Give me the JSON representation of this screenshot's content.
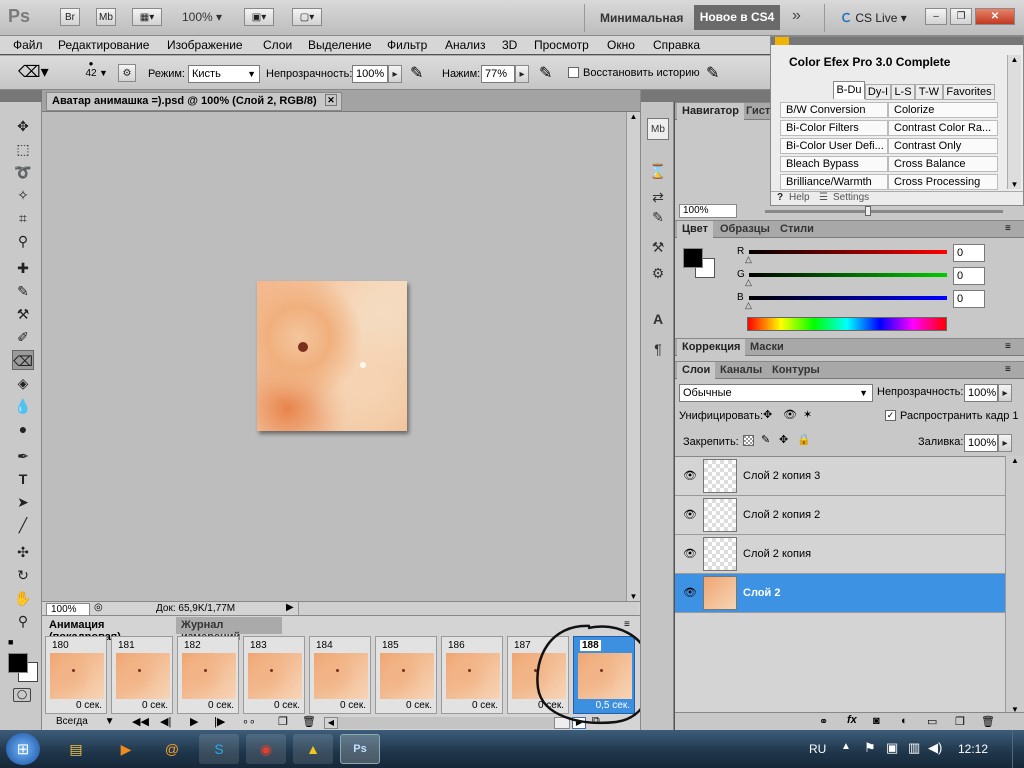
{
  "appbar": {
    "logo": "Ps",
    "bridge": "Br",
    "minibridge": "Mb",
    "zoom": "100%",
    "workspace": "Минимальная",
    "whats_new": "Новое в CS4",
    "cs_live": "CS Live"
  },
  "menu": [
    "Файл",
    "Редактирование",
    "Изображение",
    "Слои",
    "Выделение",
    "Фильтр",
    "Анализ",
    "3D",
    "Просмотр",
    "Окно",
    "Справка"
  ],
  "options": {
    "brush_size": "42",
    "mode_label": "Режим:",
    "mode_value": "Кисть",
    "opacity_label": "Непрозрачность:",
    "opacity_value": "100%",
    "pressure_label": "Нажим:",
    "pressure_value": "77%",
    "restore_label": "Восстановить историю"
  },
  "document": {
    "tab_title": "Аватар анимашка =).psd @ 100% (Слой 2, RGB/8)",
    "zoom": "100%",
    "doc_info": "Док: 65,9K/1,77M"
  },
  "animation": {
    "tab_active": "Анимация (покадровая)",
    "tab_other": "Журнал измерений",
    "loop": "Всегда",
    "frames": [
      {
        "num": "180",
        "delay": "0 сек."
      },
      {
        "num": "181",
        "delay": "0 сек."
      },
      {
        "num": "182",
        "delay": "0 сек."
      },
      {
        "num": "183",
        "delay": "0 сек."
      },
      {
        "num": "184",
        "delay": "0 сек."
      },
      {
        "num": "185",
        "delay": "0 сек."
      },
      {
        "num": "186",
        "delay": "0 сек."
      },
      {
        "num": "187",
        "delay": "0 сек."
      },
      {
        "num": "188",
        "delay": "0,5 сек."
      }
    ]
  },
  "color_efex": {
    "title": "Color Efex Pro 3.0 Complete",
    "tabs": [
      "B-Du",
      "Dy-I",
      "L-S",
      "T-W",
      "Favorites"
    ],
    "left": [
      "B/W Conversion",
      "Bi-Color Filters",
      "Bi-Color User Defi...",
      "Bleach Bypass",
      "Brilliance/Warmth"
    ],
    "right": [
      "Colorize",
      "Contrast Color Ra...",
      "Contrast Only",
      "Cross Balance",
      "Cross Processing"
    ],
    "help": "Help",
    "settings": "Settings"
  },
  "navigator": {
    "tab": "Навигатор",
    "tab2": "Гист",
    "zoom": "100%"
  },
  "color_panel": {
    "tabs": [
      "Цвет",
      "Образцы",
      "Стили"
    ],
    "r_label": "R",
    "g_label": "G",
    "b_label": "B",
    "r": "0",
    "g": "0",
    "b": "0",
    "r_level": 0,
    "g_level": 0,
    "b_level": 0
  },
  "adjust_panel": {
    "tabs": [
      "Коррекция",
      "Маски"
    ]
  },
  "layers_panel": {
    "tabs": [
      "Слои",
      "Каналы",
      "Контуры"
    ],
    "blend": "Обычные",
    "opacity_label": "Непрозрачность:",
    "opacity": "100%",
    "unify_label": "Унифицировать:",
    "propagate_label": "Распространить кадр 1",
    "lock_label": "Закрепить:",
    "fill_label": "Заливка:",
    "fill": "100%",
    "layers": [
      "Слой 2 копия 3",
      "Слой 2 копия 2",
      "Слой 2 копия",
      "Слой 2"
    ]
  },
  "taskbar": {
    "lang": "RU",
    "time": "12:12"
  }
}
